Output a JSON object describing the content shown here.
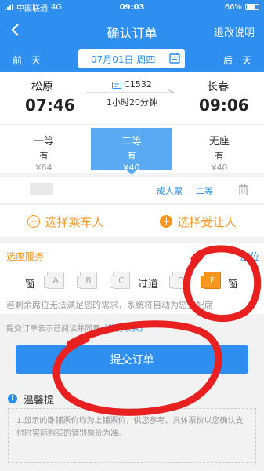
{
  "status_bar": {
    "carrier": "中国联通",
    "network": "4G",
    "time": "09:03",
    "battery": "66%"
  },
  "header": {
    "title": "确认订单",
    "help": "退改说明"
  },
  "date_bar": {
    "prev": "前一天",
    "date": "07月01日 周四",
    "next": "后一天"
  },
  "train": {
    "from_station": "松原",
    "depart_time": "07:46",
    "train_no": "C1532",
    "duration": "1小时20分钟",
    "to_station": "长春",
    "arrive_time": "09:06"
  },
  "seat_classes": [
    {
      "name": "一等",
      "availability": "有",
      "price": "¥64",
      "selected": false
    },
    {
      "name": "二等",
      "availability": "有",
      "price": "¥40",
      "selected": true
    },
    {
      "name": "无座",
      "availability": "有",
      "price": "¥40",
      "selected": false
    }
  ],
  "passenger": {
    "ticket_type": "成人票",
    "seat_class": "二等"
  },
  "actions": {
    "select_passenger": "选择乘车人",
    "select_beneficiary": "选择受让人"
  },
  "seat_service": {
    "title": "选座服务",
    "right_label": "座位",
    "window_left": "窗",
    "aisle": "过道",
    "window_right": "窗",
    "seats": [
      "A",
      "B",
      "C",
      "D",
      "F"
    ],
    "selected_seat": "F",
    "note": "若剩余席位无法满足您的需求，系统将自动为您分配席"
  },
  "agreement": {
    "text": "提交订单表示已阅读并同意",
    "link": "《服务条款》"
  },
  "submit": "提交订单",
  "tips": {
    "title": "温馨提",
    "text": "1.显示的卧铺票价均为上铺票价，供您参考。具体票价以您确认支付时实际购买的铺别票价为准。"
  },
  "colors": {
    "primary": "#2f8ff0",
    "accent": "#f7961e",
    "annotation": "#e8201f"
  }
}
